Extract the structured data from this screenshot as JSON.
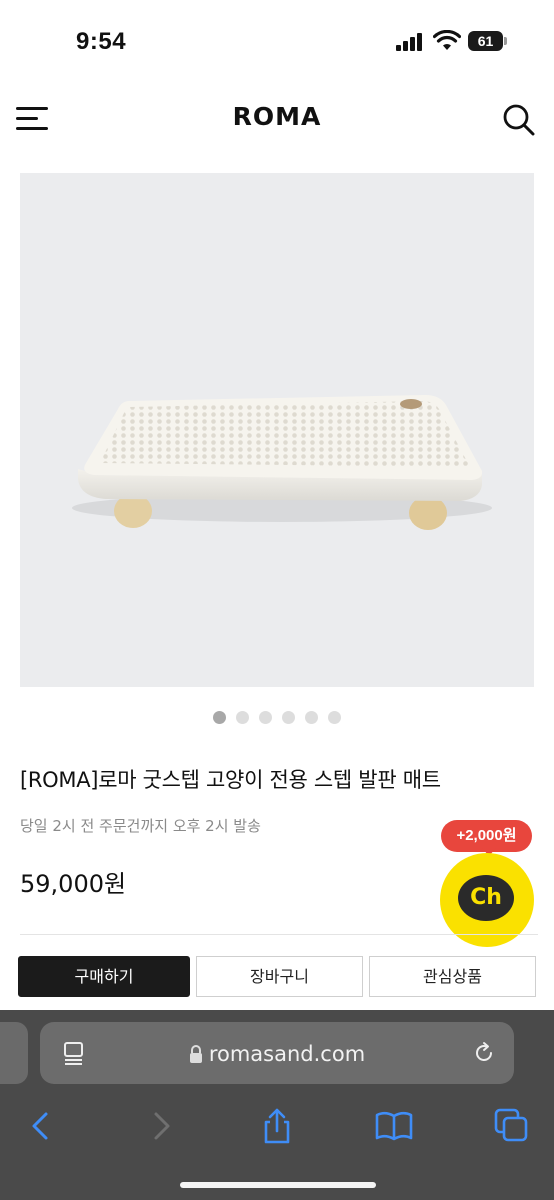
{
  "status_bar": {
    "time": "9:54",
    "battery": "61"
  },
  "header": {
    "logo": "ROMA",
    "icons": [
      "hamburger-menu-icon",
      "search-icon"
    ]
  },
  "gallery": {
    "total_images": 6,
    "active_index": 0,
    "image": "white-cat-step-mat-on-wooden-legs"
  },
  "product": {
    "title": "[ROMA]로마 굿스텝 고양이 전용 스텝 발판 매트",
    "shipping_note": "당일 2시 전 주문건까지 오후 2시 발송",
    "price": "59,000원"
  },
  "actions": {
    "buy": "구매하기",
    "cart": "장바구니",
    "wishlist": "관심상품"
  },
  "chat_widget": {
    "badge": "+2,000원",
    "label": "Ch",
    "color": "#fae100"
  },
  "browser": {
    "url": "romasand.com"
  },
  "colors": {
    "accent_dark": "#1b1b1b",
    "badge_red": "#e8463d",
    "chat_yellow": "#fae100"
  }
}
